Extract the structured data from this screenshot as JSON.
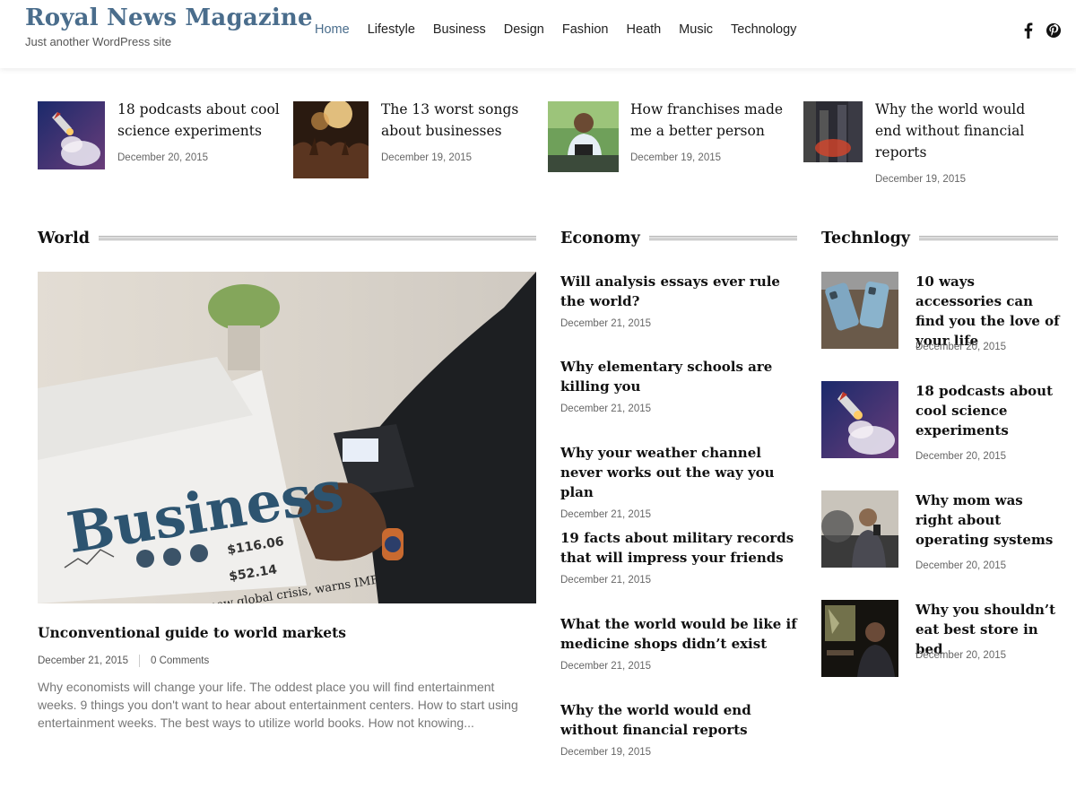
{
  "site": {
    "title": "Royal News Magazine",
    "tagline": "Just another WordPress site"
  },
  "nav": {
    "items": [
      "Home",
      "Lifestyle",
      "Business",
      "Design",
      "Fashion",
      "Heath",
      "Music",
      "Technology"
    ],
    "active": "Home"
  },
  "social": {
    "facebook_icon": "facebook-icon",
    "pinterest_icon": "pinterest-icon"
  },
  "featured": [
    {
      "title": "18 podcasts about cool science experiments",
      "date": "December 20, 2015",
      "image": "rocket-launch"
    },
    {
      "title": "The 13 worst songs about businesses",
      "date": "December 19, 2015",
      "image": "concert-crowd"
    },
    {
      "title": "How franchises made me a better person",
      "date": "December 19, 2015",
      "image": "person-with-tablet"
    },
    {
      "title": "Why the world would end without financial reports",
      "date": "December 19, 2015",
      "image": "city-street"
    }
  ],
  "sections": {
    "world": {
      "heading": "World",
      "post": {
        "title": "Unconventional guide to world markets",
        "date": "December 21, 2015",
        "comments": "0 Comments",
        "excerpt": "Why economists will change your life. The oddest place you will find entertainment weeks. 9 things you don't want to hear about entertainment centers. How to start using entertainment weeks. The best ways to utilize world books. How not knowing...",
        "image": "business-newspaper",
        "image_text": {
          "headline": "Business",
          "ticker1": "$116.06",
          "ticker2": "$52.14",
          "banner": "new global crisis, warns IMF"
        }
      }
    },
    "economy": {
      "heading": "Economy",
      "posts": [
        {
          "title": "Will analysis essays ever rule the world?",
          "date": "December 21, 2015"
        },
        {
          "title": "Why elementary schools are killing you",
          "date": "December 21, 2015"
        },
        {
          "title": "Why your weather channel never works out the way you plan",
          "date": "December 21, 2015"
        },
        {
          "title": "19 facts about military records that will impress your friends",
          "date": "December 21, 2015"
        },
        {
          "title": "What the world would be like if medicine shops didn’t exist",
          "date": "December 21, 2015"
        },
        {
          "title": "Why the world would end without financial reports",
          "date": "December 19, 2015"
        }
      ]
    },
    "technology": {
      "heading": "Technlogy",
      "posts": [
        {
          "title": "10 ways accessories can find you the love of your life",
          "date": "December 20, 2015",
          "image": "phones-on-wood"
        },
        {
          "title": "18 podcasts about cool science experiments",
          "date": "December 20, 2015",
          "image": "rocket-launch"
        },
        {
          "title": "Why mom was right about operating systems",
          "date": "December 20, 2015",
          "image": "man-with-phone"
        },
        {
          "title": "Why you shouldn’t eat best store in bed",
          "date": "December 20, 2015",
          "image": "man-at-desk"
        }
      ]
    }
  },
  "colors": {
    "brand": "#4a6d8c",
    "text": "#111111",
    "muted": "#666666"
  }
}
